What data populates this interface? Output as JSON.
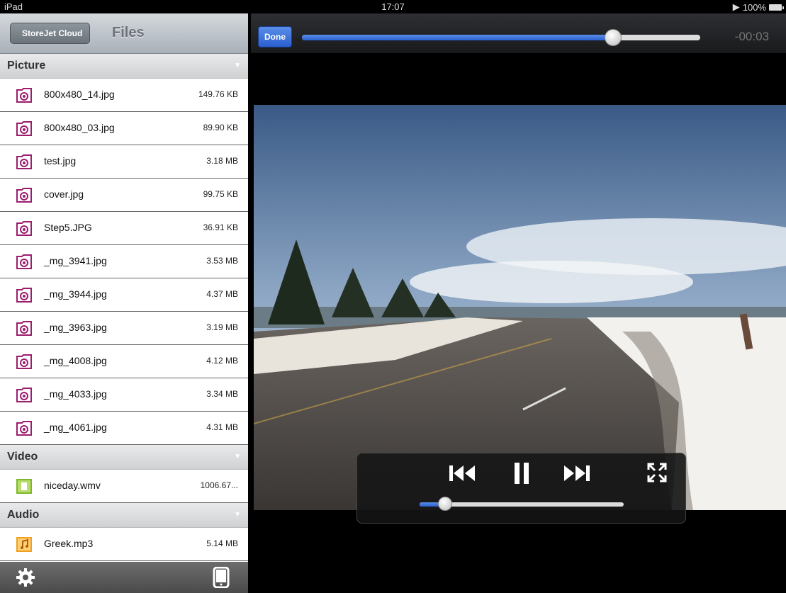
{
  "status": {
    "device": "iPad",
    "time": "17:07",
    "battery": "100%"
  },
  "nav": {
    "back_label": "StoreJet Cloud",
    "title": "Files"
  },
  "sections": [
    {
      "label": "Picture",
      "items": [
        {
          "name": "800x480_14.jpg",
          "size": "149.76 KB",
          "icon": "photo-file-icon"
        },
        {
          "name": "800x480_03.jpg",
          "size": "89.90 KB",
          "icon": "photo-file-icon"
        },
        {
          "name": "test.jpg",
          "size": "3.18 MB",
          "icon": "photo-file-icon"
        },
        {
          "name": "cover.jpg",
          "size": "99.75 KB",
          "icon": "photo-file-icon"
        },
        {
          "name": "Step5.JPG",
          "size": "36.91 KB",
          "icon": "photo-file-icon"
        },
        {
          "name": "_mg_3941.jpg",
          "size": "3.53 MB",
          "icon": "photo-file-icon"
        },
        {
          "name": "_mg_3944.jpg",
          "size": "4.37 MB",
          "icon": "photo-file-icon"
        },
        {
          "name": "_mg_3963.jpg",
          "size": "3.19 MB",
          "icon": "photo-file-icon"
        },
        {
          "name": "_mg_4008.jpg",
          "size": "4.12 MB",
          "icon": "photo-file-icon"
        },
        {
          "name": "_mg_4033.jpg",
          "size": "3.34 MB",
          "icon": "photo-file-icon"
        },
        {
          "name": "_mg_4061.jpg",
          "size": "4.31 MB",
          "icon": "photo-file-icon"
        }
      ]
    },
    {
      "label": "Video",
      "items": [
        {
          "name": "niceday.wmv",
          "size": "1006.67...",
          "icon": "video-file-icon"
        }
      ]
    },
    {
      "label": "Audio",
      "items": [
        {
          "name": "Greek.mp3",
          "size": "5.14 MB",
          "icon": "audio-file-icon"
        }
      ]
    }
  ],
  "player": {
    "done_label": "Done",
    "time_remaining": "-00:03",
    "scrub_progress": 0.78,
    "hud_progress": 0.12
  },
  "colors": {
    "accent": "#2a5fcf",
    "photo_icon": "#9b1d6e",
    "video_icon": "#7cb82f",
    "audio_icon": "#f0a020"
  }
}
